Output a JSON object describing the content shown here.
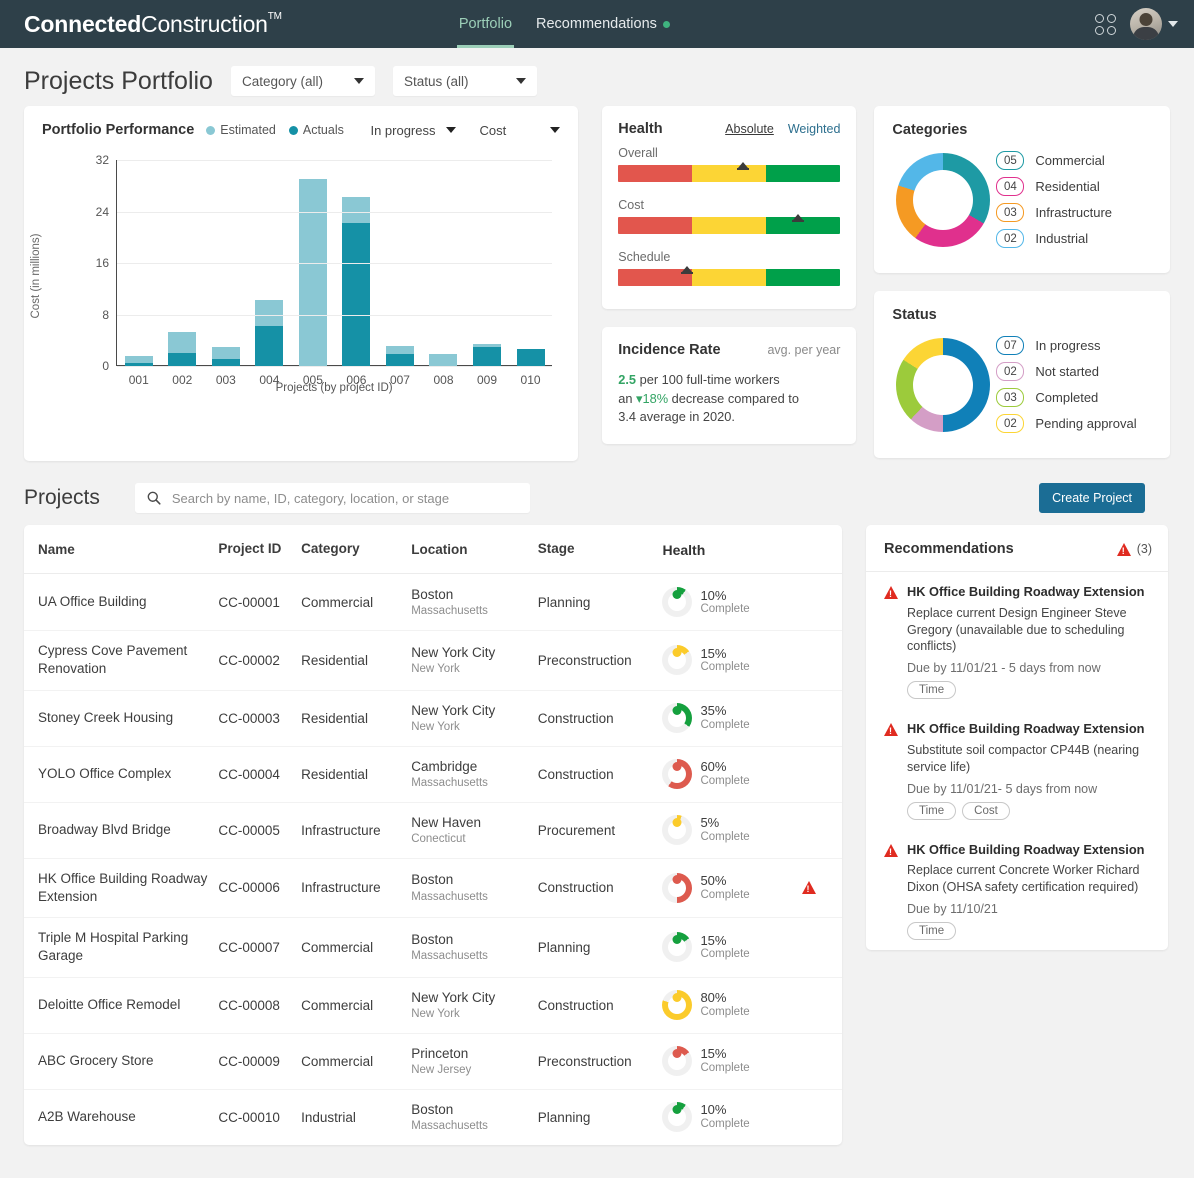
{
  "nav": {
    "brand_bold": "Connected",
    "brand_light": "Construction",
    "brand_tm": "TM",
    "links": [
      {
        "label": "Portfolio",
        "active": true,
        "dot": false
      },
      {
        "label": "Recommendations",
        "active": false,
        "dot": true
      }
    ],
    "apps_icon": "grid-apps-icon",
    "avatar_icon": "user-avatar",
    "accent": "#9ccfb8",
    "bar_bg": "#2e4049"
  },
  "page": {
    "title": "Projects Portfolio",
    "filters": [
      {
        "label": "Category (all)"
      },
      {
        "label": "Status (all)"
      }
    ]
  },
  "performance": {
    "title": "Portfolio Performance",
    "legend": [
      {
        "label": "Estimated",
        "color": "#8ac8d4"
      },
      {
        "label": "Actuals",
        "color": "#1591a6"
      }
    ],
    "selects": [
      {
        "label": "In progress"
      },
      {
        "label": "Cost"
      }
    ]
  },
  "chart_data": {
    "type": "bar",
    "title": "Portfolio Performance",
    "xlabel": "Projects (by project ID)",
    "ylabel": "Cost (in millions)",
    "ylim": [
      0,
      32
    ],
    "yticks": [
      0,
      8,
      16,
      24,
      32
    ],
    "grid": true,
    "legend_position": "top-left",
    "stacked": true,
    "categories": [
      "001",
      "002",
      "003",
      "004",
      "005",
      "006",
      "007",
      "008",
      "009",
      "010"
    ],
    "series": [
      {
        "name": "Estimated",
        "color": "#8ac8d4",
        "values": [
          1.5,
          5.3,
          3.0,
          10.3,
          29.0,
          26.2,
          3.1,
          1.8,
          3.4,
          2.6
        ]
      },
      {
        "name": "Actuals",
        "color": "#1591a6",
        "values": [
          0.4,
          2.0,
          1.1,
          6.2,
          0.0,
          22.2,
          1.8,
          0.0,
          2.9,
          2.6
        ]
      }
    ]
  },
  "health": {
    "title": "Health",
    "toggles": [
      {
        "label": "Absolute",
        "active": true
      },
      {
        "label": "Weighted",
        "active": false
      }
    ],
    "colors": {
      "red": "#e2564d",
      "yellow": "#fcd535",
      "green": "#00a04a"
    },
    "rows": [
      {
        "label": "Overall",
        "marker_pct": 56
      },
      {
        "label": "Cost",
        "marker_pct": 81
      },
      {
        "label": "Schedule",
        "marker_pct": 31
      }
    ]
  },
  "incidence": {
    "title": "Incidence Rate",
    "subtitle": "avg. per year",
    "rate": "2.5",
    "text1": " per 100 full-time workers",
    "text2": "an ",
    "change": "▾18%",
    "text3": " decrease compared to",
    "text4": "3.4 average in 2020."
  },
  "categories": {
    "title": "Categories",
    "donut": [
      {
        "color": "#1e9aa4",
        "pct": 33.3
      },
      {
        "color": "#e0308d",
        "pct": 26.7
      },
      {
        "color": "#f59a23",
        "pct": 20.0
      },
      {
        "color": "#53b7e8",
        "pct": 20.0
      }
    ],
    "items": [
      {
        "count": "05",
        "label": "Commercial",
        "color": "#1e9aa4"
      },
      {
        "count": "04",
        "label": "Residential",
        "color": "#e0308d"
      },
      {
        "count": "03",
        "label": "Infrastructure",
        "color": "#f59a23"
      },
      {
        "count": "02",
        "label": "Industrial",
        "color": "#53b7e8"
      }
    ]
  },
  "status": {
    "title": "Status",
    "donut": [
      {
        "color": "#1080b8",
        "pct": 50.0
      },
      {
        "color": "#d49ec6",
        "pct": 12.0
      },
      {
        "color": "#9ccb3b",
        "pct": 22.0
      },
      {
        "color": "#fcd535",
        "pct": 16.0
      }
    ],
    "items": [
      {
        "count": "07",
        "label": "In progress",
        "color": "#1080b8"
      },
      {
        "count": "02",
        "label": "Not started",
        "color": "#d49ec6"
      },
      {
        "count": "03",
        "label": "Completed",
        "color": "#9ccb3b"
      },
      {
        "count": "02",
        "label": "Pending approval",
        "color": "#fcd535"
      }
    ]
  },
  "projects": {
    "title": "Projects",
    "search_placeholder": "Search by name, ID, category, location, or stage",
    "search_value": "",
    "search_icon": "search-icon",
    "create_label": "Create Project",
    "create_color": "#1b6d95",
    "columns": [
      "Name",
      "Project ID",
      "Category",
      "Location",
      "Stage",
      "Health"
    ],
    "rows": [
      {
        "name": "UA Office Building",
        "id": "CC-00001",
        "category": "Commercial",
        "city": "Boston",
        "state": "Massachusetts",
        "stage": "Planning",
        "pct": 10,
        "pct_label": "10%",
        "complete_label": "Complete",
        "color": "#15a03e",
        "alert": false
      },
      {
        "name": "Cypress Cove Pavement Renovation",
        "id": "CC-00002",
        "category": "Residential",
        "city": "New York City",
        "state": "New York",
        "stage": "Preconstruction",
        "pct": 15,
        "pct_label": "15%",
        "complete_label": "Complete",
        "color": "#fbcb2b",
        "alert": false
      },
      {
        "name": "Stoney Creek Housing",
        "id": "CC-00003",
        "category": "Residential",
        "city": "New York City",
        "state": "New York",
        "stage": "Construction",
        "pct": 35,
        "pct_label": "35%",
        "complete_label": "Complete",
        "color": "#15a03e",
        "alert": false
      },
      {
        "name": "YOLO Office Complex",
        "id": "CC-00004",
        "category": "Residential",
        "city": "Cambridge",
        "state": "Massachusetts",
        "stage": "Construction",
        "pct": 60,
        "pct_label": "60%",
        "complete_label": "Complete",
        "color": "#dd5a4e",
        "alert": false
      },
      {
        "name": "Broadway Blvd Bridge",
        "id": "CC-00005",
        "category": "Infrastructure",
        "city": "New Haven",
        "state": "Conecticut",
        "stage": "Procurement",
        "pct": 5,
        "pct_label": "5%",
        "complete_label": "Complete",
        "color": "#fbcb2b",
        "alert": false
      },
      {
        "name": "HK Office Building Roadway Extension",
        "id": "CC-00006",
        "category": "Infrastructure",
        "city": "Boston",
        "state": "Massachusetts",
        "stage": "Construction",
        "pct": 50,
        "pct_label": "50%",
        "complete_label": "Complete",
        "color": "#dd5a4e",
        "alert": true
      },
      {
        "name": "Triple M Hospital Parking Garage",
        "id": "CC-00007",
        "category": "Commercial",
        "city": "Boston",
        "state": "Massachusetts",
        "stage": "Planning",
        "pct": 15,
        "pct_label": "15%",
        "complete_label": "Complete",
        "color": "#15a03e",
        "alert": false
      },
      {
        "name": "Deloitte Office Remodel",
        "id": "CC-00008",
        "category": "Commercial",
        "city": "New York City",
        "state": "New York",
        "stage": "Construction",
        "pct": 80,
        "pct_label": "80%",
        "complete_label": "Complete",
        "color": "#fbcb2b",
        "alert": false
      },
      {
        "name": "ABC Grocery Store",
        "id": "CC-00009",
        "category": "Commercial",
        "city": "Princeton",
        "state": "New Jersey",
        "stage": "Preconstruction",
        "pct": 15,
        "pct_label": "15%",
        "complete_label": "Complete",
        "color": "#dd5a4e",
        "alert": false
      },
      {
        "name": "A2B Warehouse",
        "id": "CC-00010",
        "category": "Industrial",
        "city": "Boston",
        "state": "Massachusetts",
        "stage": "Planning",
        "pct": 10,
        "pct_label": "10%",
        "complete_label": "Complete",
        "color": "#15a03e",
        "alert": false
      }
    ]
  },
  "recommendations": {
    "title": "Recommendations",
    "count": "(3)",
    "warning_icon": "warning-triangle-icon",
    "items": [
      {
        "project": "HK Office Building Roadway Extension",
        "desc": "Replace current Design Engineer Steve Gregory (unavailable due to scheduling conflicts)",
        "due": "Due by 11/01/21 - 5 days from now",
        "tags": [
          "Time"
        ]
      },
      {
        "project": "HK Office Building Roadway Extension",
        "desc": "Substitute soil compactor CP44B (nearing service life)",
        "due": "Due by 11/01/21- 5 days from now",
        "tags": [
          "Time",
          "Cost"
        ]
      },
      {
        "project": "HK Office Building Roadway Extension",
        "desc": "Replace current Concrete Worker Richard Dixon (OHSA safety certification required)",
        "due": "Due by 11/10/21",
        "tags": [
          "Time"
        ]
      }
    ]
  }
}
